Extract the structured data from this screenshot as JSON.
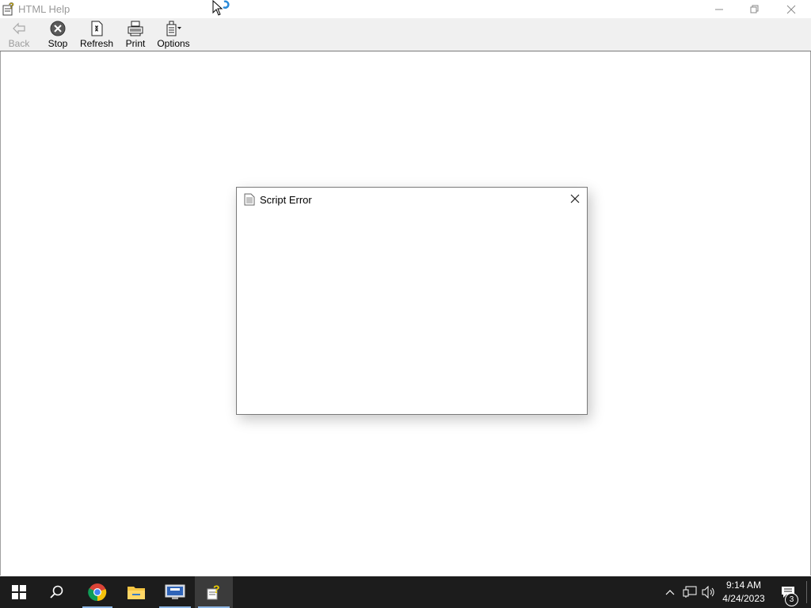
{
  "window": {
    "title": "HTML Help"
  },
  "toolbar": {
    "back_label": "Back",
    "stop_label": "Stop",
    "refresh_label": "Refresh",
    "print_label": "Print",
    "options_label": "Options"
  },
  "dialog": {
    "title": "Script Error"
  },
  "taskbar": {
    "apps": [
      "start-icon",
      "search-icon",
      "chrome-icon",
      "file-explorer-icon",
      "remote-desktop-icon",
      "html-help-icon"
    ],
    "clock_time": "9:14 AM",
    "clock_date": "4/24/2023",
    "notification_count": "3"
  },
  "colors": {
    "taskbar_bg": "#1c1c1c",
    "toolbar_bg": "#f0f0f0",
    "active_task_underline": "#8fb8e6"
  }
}
